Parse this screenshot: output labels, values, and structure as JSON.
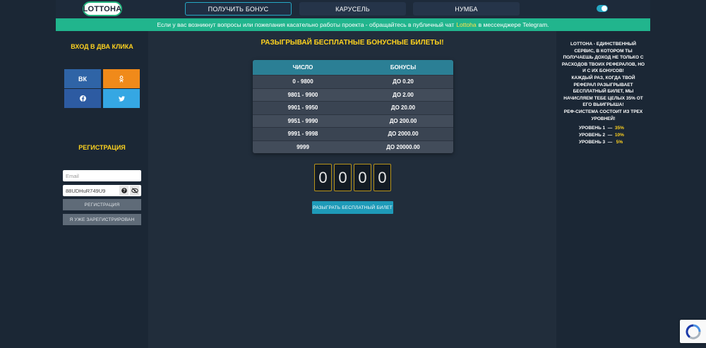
{
  "header": {
    "logo": "LOTTOHA",
    "nav": [
      "ПОЛУЧИТЬ БОНУС",
      "КАРУСЕЛЬ",
      "НУМБА"
    ]
  },
  "banner": {
    "text_before": "Если у вас возникнут вопросы или пожелания касательно работы проекта - обращайтесь в публичный чат",
    "link": "Lottoha",
    "text_after": "в мессенджере Telegram."
  },
  "left": {
    "quick_login_title": "ВХОД В ДВА КЛИКА",
    "social": {
      "vk": "ВК",
      "ok": "ОК",
      "fb": "f",
      "tw": "t"
    },
    "register_title": "РЕГИСТРАЦИЯ",
    "email_placeholder": "Email",
    "password_value": "88UDHuR749U9",
    "register_button": "РЕГИСТРАЦИЯ",
    "already_button": "Я УЖЕ ЗАРЕГИСТРИРОВАН"
  },
  "main": {
    "title": "РАЗЫГРЫВАЙ БЕСПЛАТНЫЕ БОНУСНЫЕ БИЛЕТЫ!",
    "table_headers": [
      "ЧИСЛО",
      "БОНУСЫ"
    ],
    "table_rows": [
      [
        "0 - 9800",
        "ДО 0.20"
      ],
      [
        "9801 - 9900",
        "ДО 2.00"
      ],
      [
        "9901 - 9950",
        "ДО 20.00"
      ],
      [
        "9951 - 9990",
        "ДО 200.00"
      ],
      [
        "9991 - 9998",
        "ДО 2000.00"
      ],
      [
        "9999",
        "ДО 20000.00"
      ]
    ],
    "digits": [
      "0",
      "0",
      "0",
      "0"
    ],
    "play_button": "РАЗЫГРАТЬ БЕСПЛАТНЫЙ БИЛЕТ"
  },
  "right": {
    "para1": "LOTTOHA - ЕДИНСТВЕННЫЙ СЕРВИС, В КОТОРОМ ТЫ ПОЛУЧАЕШЬ ДОХОД НЕ ТОЛЬКО С РАСХОДОВ ТВОИХ РЕФЕРАЛОВ, НО И С ИХ БОНУСОВ!",
    "para2": "КАЖДЫЙ РАЗ, КОГДА ТВОЙ РЕФЕРАЛ РАЗЫГРЫВАЕТ БЕСПЛАТНЫЙ БИЛЕТ, МЫ НАЧИСЛЯЕМ ТЕБЕ ЦЕЛЫХ 35% ОТ ЕГО ВЫИГРЫША!",
    "para3": "РЕФ-СИСТЕМА СОСТОИТ ИЗ ТРЕХ УРОВНЕЙ!",
    "levels": [
      {
        "label": "УРОВЕНЬ 1",
        "pct": "35%"
      },
      {
        "label": "УРОВЕНЬ 2",
        "pct": "10%"
      },
      {
        "label": "УРОВЕНЬ 3",
        "pct": "5%"
      }
    ]
  },
  "colors": {
    "accent": "#25a8c4",
    "banner": "#21b58d",
    "yellow": "#ffd21f"
  }
}
